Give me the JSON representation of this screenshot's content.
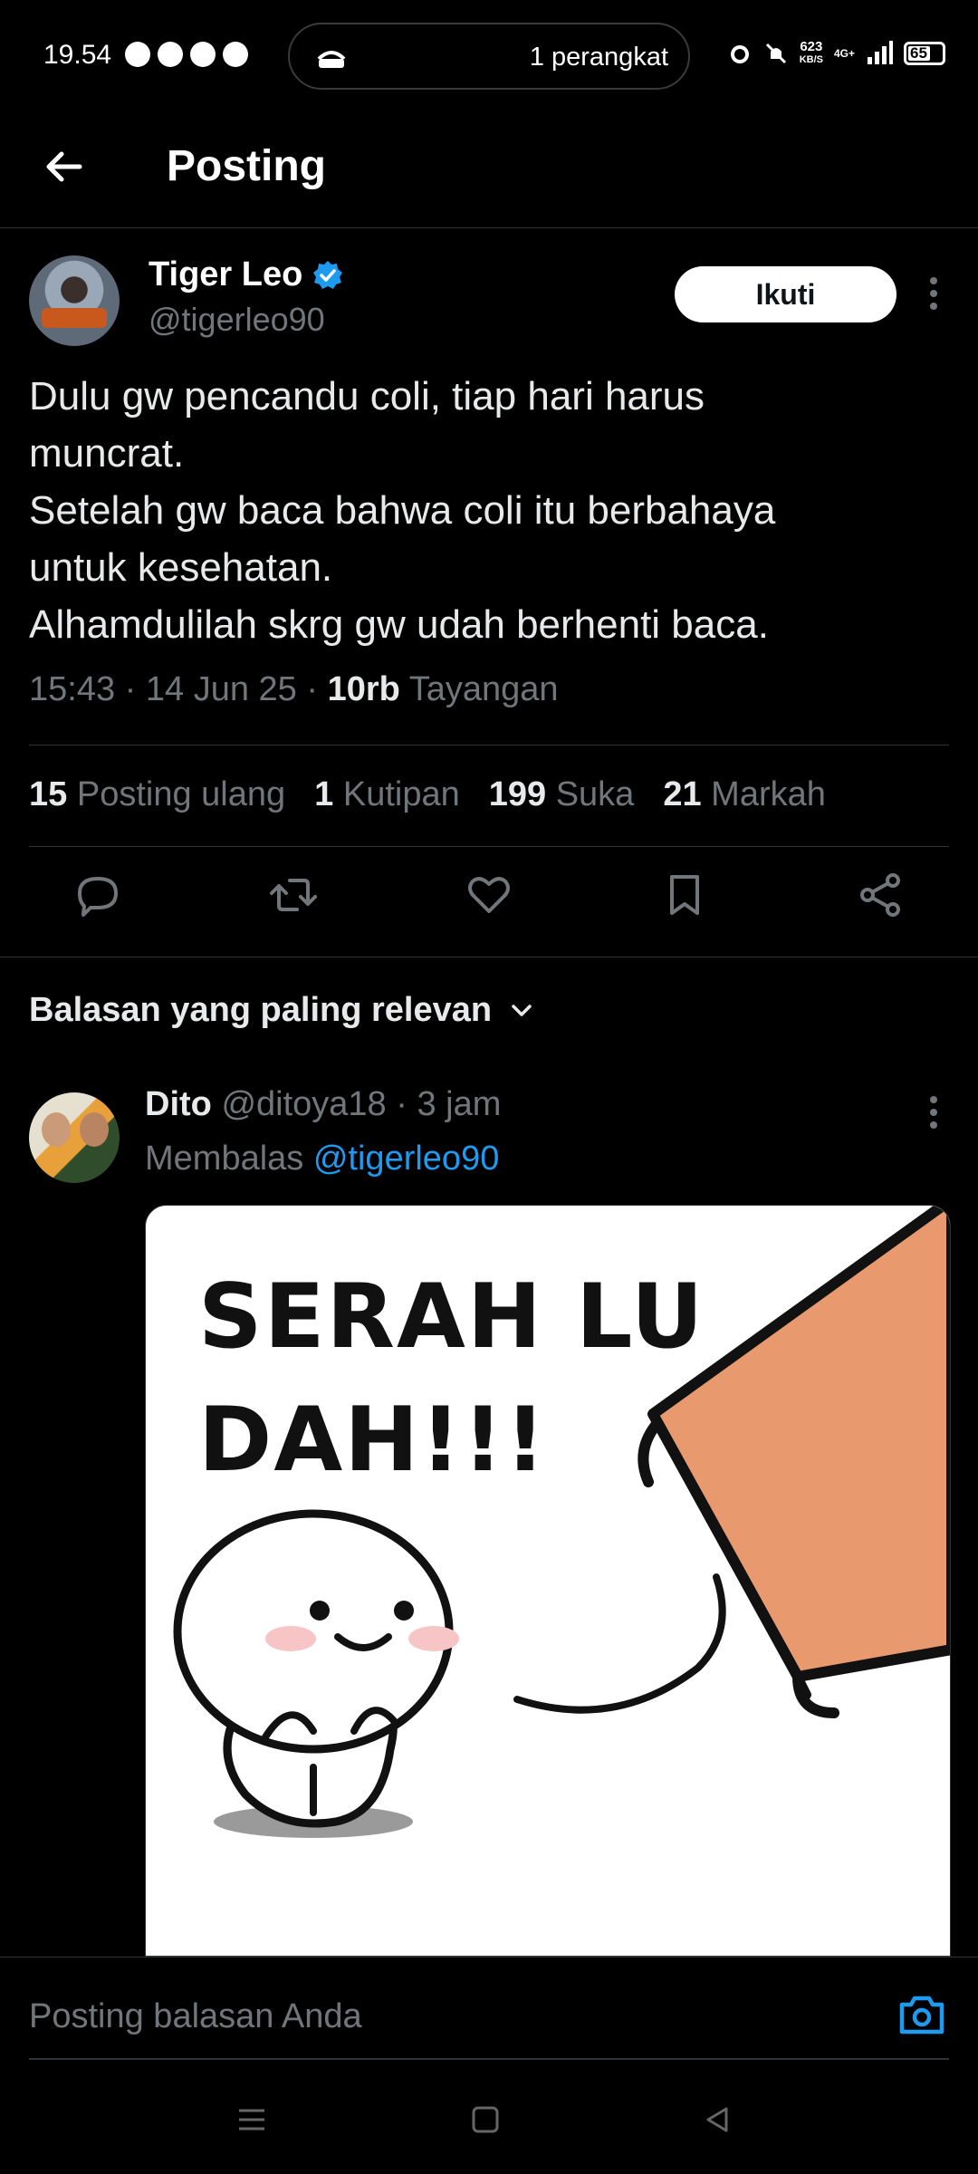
{
  "status_bar": {
    "time": "19.54",
    "pill_text": "1 perangkat",
    "net_speed": "623",
    "net_unit": "KB/S",
    "net_type": "4G+",
    "battery": "65"
  },
  "header": {
    "title": "Posting"
  },
  "post": {
    "author_name": "Tiger Leo",
    "author_handle": "@tigerleo90",
    "follow_label": "Ikuti",
    "text_lines": [
      "Dulu gw pencandu coli, tiap hari harus",
      "muncrat.",
      "Setelah gw baca bahwa coli itu berbahaya",
      "untuk kesehatan.",
      "Alhamdulilah skrg gw udah berhenti baca."
    ],
    "time": "15:43",
    "date": "14 Jun 25",
    "views_count": "10rb",
    "views_label": "Tayangan",
    "stats": {
      "reposts_count": "15",
      "reposts_label": "Posting ulang",
      "quotes_count": "1",
      "quotes_label": "Kutipan",
      "likes_count": "199",
      "likes_label": "Suka",
      "bookmarks_count": "21",
      "bookmarks_label": "Markah"
    }
  },
  "replies": {
    "sort_label": "Balasan yang paling relevan",
    "items": [
      {
        "name": "Dito",
        "handle": "@ditoya18",
        "age": "3 jam",
        "replying_label": "Membalas",
        "replying_to": "@tigerleo90",
        "meme_line1": "SERAH LU",
        "meme_line2": "DAH!!!"
      }
    ]
  },
  "composer": {
    "placeholder": "Posting balasan Anda"
  },
  "colors": {
    "background": "#000000",
    "text": "#e7e9ea",
    "muted": "#71767b",
    "accent": "#1d9bf0",
    "divider": "#2f3336"
  }
}
